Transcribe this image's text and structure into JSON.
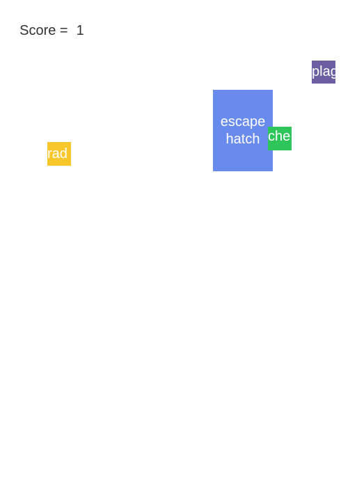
{
  "hud": {
    "score_label": "Score =",
    "score_value": "1"
  },
  "cards": {
    "escape_hatch": {
      "label": "escape hatch",
      "color": "#6a8bee"
    },
    "rad": {
      "label": "rad",
      "color": "#f8c72c"
    },
    "plag": {
      "label": "plag",
      "color": "#6b5fa1"
    },
    "che": {
      "label": "che su",
      "color": "#2ec55a"
    }
  }
}
